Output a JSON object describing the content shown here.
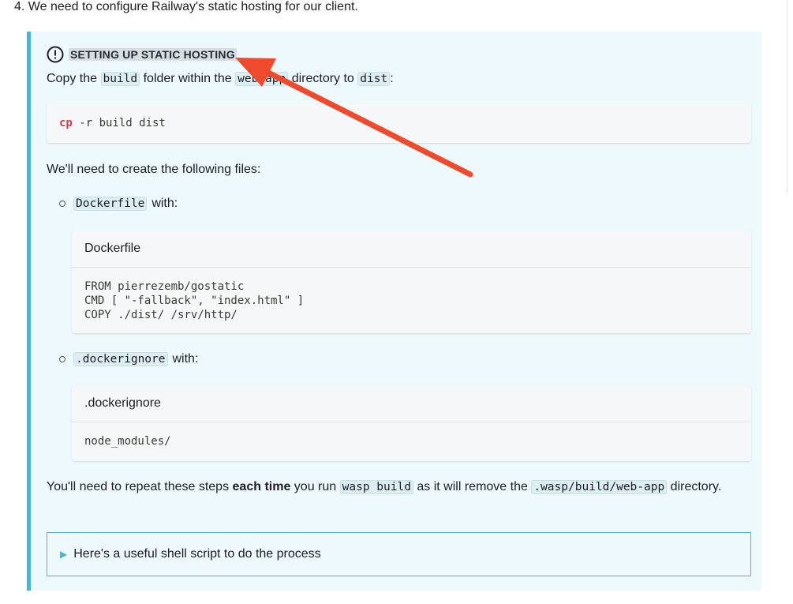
{
  "step": {
    "text": "4. We need to configure Railway's static hosting for our client."
  },
  "admonition": {
    "icon": "info-exclamation-icon",
    "title": "SETTING UP STATIC HOSTING",
    "copy_para": {
      "pre": "Copy the",
      "code1": "build",
      "mid": "folder within the",
      "code2": "web-app",
      "mid2": "directory to",
      "code3": "dist",
      "post": ":"
    },
    "cp_command": {
      "keyword": "cp",
      "args": " -r build dist"
    },
    "files_intro": "We'll need to create the following files:",
    "files": [
      {
        "name_code": "Dockerfile",
        "with_text": "with:",
        "block_title": "Dockerfile",
        "lines": [
          "FROM pierrezemb/gostatic",
          "CMD [ \"-fallback\", \"index.html\" ]",
          "COPY ./dist/ /srv/http/"
        ]
      },
      {
        "name_code": ".dockerignore",
        "with_text": "with:",
        "block_title": ".dockerignore",
        "lines": [
          "node_modules/"
        ]
      }
    ],
    "repeat_para": {
      "pre": "You'll need to repeat these steps",
      "bold": "each time",
      "mid": "you run",
      "code1": "wasp build",
      "mid2": "as it will remove the",
      "code2": ".wasp/build/web-app",
      "post": "directory."
    },
    "details_summary": "Here's a useful shell script to do the process"
  },
  "annotation": {
    "color": "#ef4a2b"
  },
  "colors": {
    "admonition_bg": "#eef9fd",
    "admonition_border": "#4cb3d4",
    "keyword": "#d73a49"
  }
}
